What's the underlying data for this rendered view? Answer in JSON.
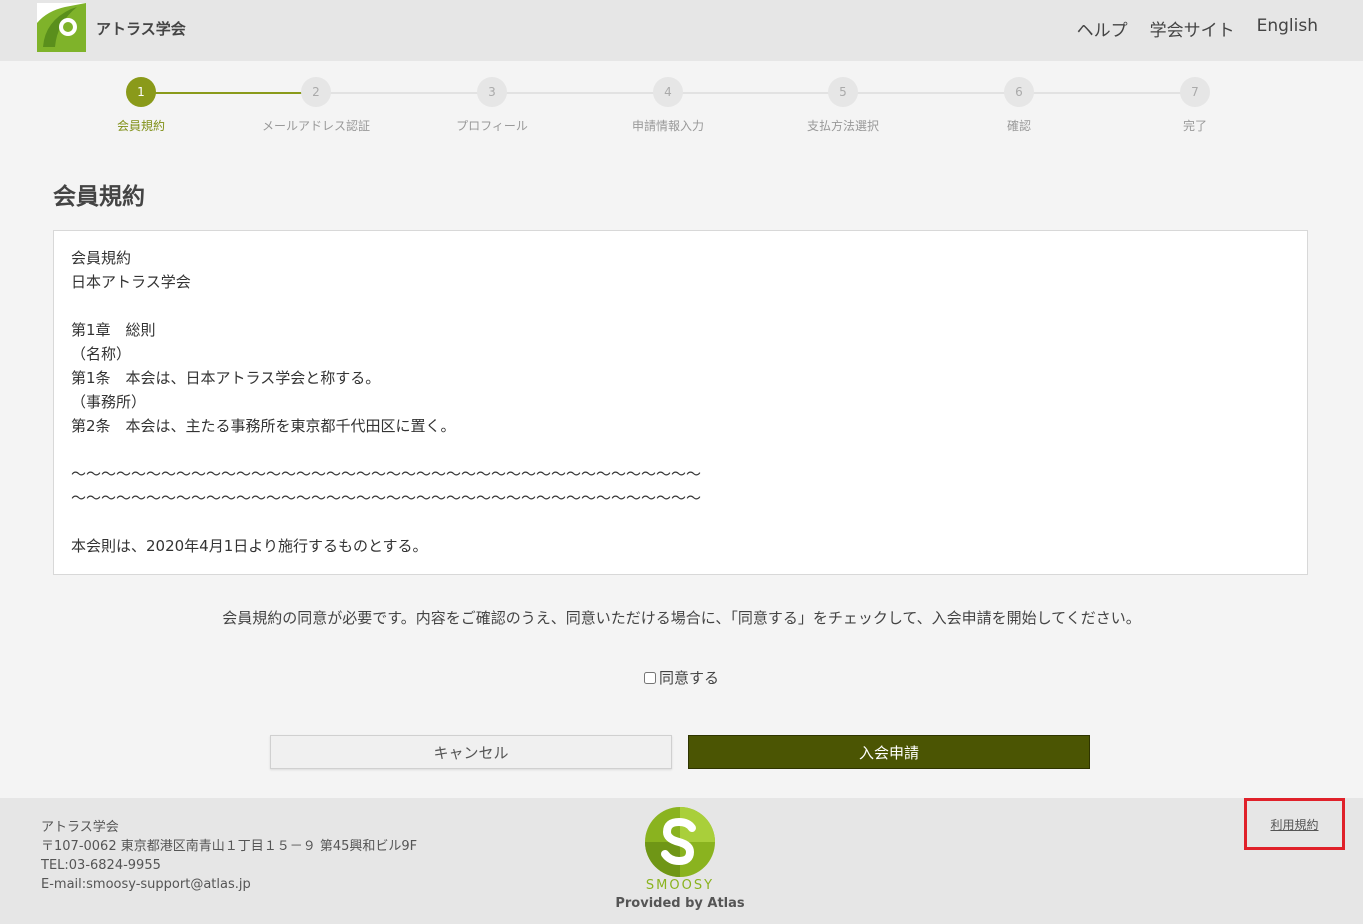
{
  "header": {
    "logo_text": "アトラス学会",
    "nav": [
      "ヘルプ",
      "学会サイト",
      "English"
    ]
  },
  "stepper": {
    "current": 1,
    "steps": [
      {
        "num": "1",
        "label": "会員規約"
      },
      {
        "num": "2",
        "label": "メールアドレス認証"
      },
      {
        "num": "3",
        "label": "プロフィール"
      },
      {
        "num": "4",
        "label": "申請情報入力"
      },
      {
        "num": "5",
        "label": "支払方法選択"
      },
      {
        "num": "6",
        "label": "確認"
      },
      {
        "num": "7",
        "label": "完了"
      }
    ]
  },
  "page_title": "会員規約",
  "terms": {
    "lines": [
      "会員規約",
      "日本アトラス学会",
      "",
      "第1章　総則",
      "（名称）",
      "第1条　本会は、日本アトラス学会と称する。",
      "（事務所）",
      "第2条　本会は、主たる事務所を東京都千代田区に置く。",
      "",
      "～～～～～～～～～～～～～～～～～～～～～～～～～～～～～～～～～～～～～～～～～～",
      "～～～～～～～～～～～～～～～～～～～～～～～～～～～～～～～～～～～～～～～～～～",
      "",
      "本会則は、2020年4月1日より施行するものとする。"
    ]
  },
  "notice": "会員規約の同意が必要です。内容をご確認のうえ、同意いただける場合に、「同意する」をチェックして、入会申請を開始してください。",
  "agree_label": "同意する",
  "buttons": {
    "cancel": "キャンセル",
    "apply": "入会申請"
  },
  "footer": {
    "org": "アトラス学会",
    "address": "〒107-0062 東京都港区南青山１丁目１５－９ 第45興和ビル9F",
    "tel": "TEL:03-6824-9955",
    "email": "E-mail:smoosy-support@atlas.jp",
    "brand": "SMOOSY",
    "provided_by": "Provided by Atlas",
    "terms_link": "利用規約"
  },
  "colors": {
    "accent": "#8a9a1a",
    "apply_button": "#4b5503",
    "highlight_border": "#e0212a"
  }
}
